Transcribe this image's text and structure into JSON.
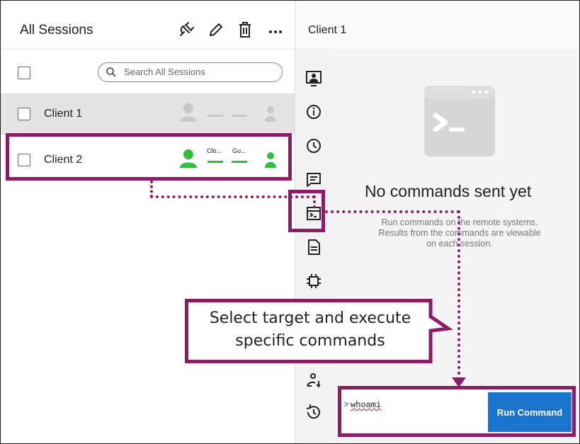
{
  "sessions_panel": {
    "title": "All Sessions",
    "search_placeholder": "Search All Sessions",
    "sessions": [
      {
        "label": "Client 1",
        "status_labels": [
          "",
          ""
        ],
        "connected": false
      },
      {
        "label": "Client 2",
        "status_labels": [
          "Clo...",
          "Gu..."
        ],
        "connected": true
      }
    ],
    "toolbar_icons": [
      "unplug-icon",
      "pencil-icon",
      "trash-icon",
      "more-icon"
    ]
  },
  "detail_panel": {
    "title": "Client 1",
    "empty_state": {
      "title": "No commands sent yet",
      "description_lines": [
        "Run commands on the remote systems.",
        "Results from the commands are viewable",
        "on each session."
      ]
    },
    "command_input": {
      "prompt": ">",
      "value": "whoami"
    },
    "run_button": "Run Command"
  },
  "rail_icons": [
    "screen-share-icon",
    "info-icon",
    "clock-icon",
    "chat-icon",
    "commands-icon",
    "document-icon",
    "chip-icon",
    "user-gear-icon",
    "history-icon"
  ],
  "annotation": {
    "callout_lines": [
      "Select target and execute",
      "specific commands"
    ]
  },
  "colors": {
    "accent": "#1a74cc",
    "annotation": "#8e1b66",
    "connected": "#2fbf3c",
    "disconnected": "#c8c8c8"
  }
}
